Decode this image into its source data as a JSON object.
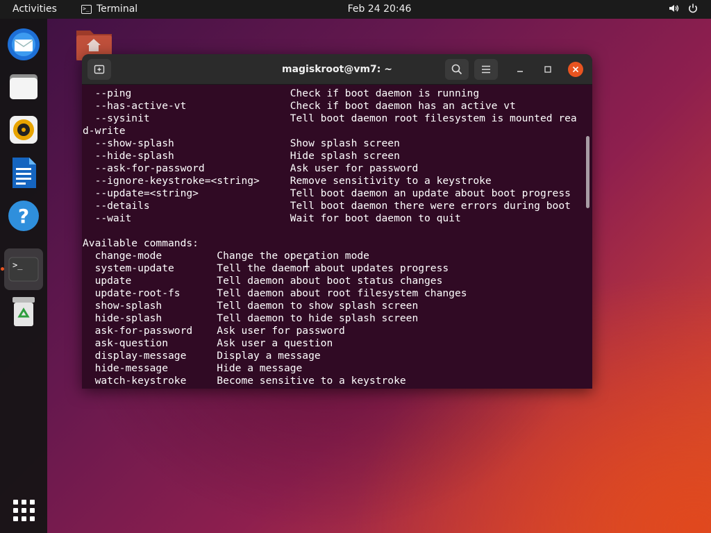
{
  "topbar": {
    "activities": "Activities",
    "app_name": "Terminal",
    "app_icon_glyph": ">_",
    "clock": "Feb 24  20:46",
    "icons": [
      "volume-icon",
      "power-icon"
    ]
  },
  "dock": {
    "items": [
      "thunderbird-icon",
      "files-icon",
      "rhythmbox-icon",
      "libreoffice-writer-icon",
      "help-icon",
      "terminal-icon",
      "trash-icon"
    ],
    "active": "terminal-icon",
    "show_apps": "show-applications-icon"
  },
  "desktop": {
    "icons": [
      "home-folder-icon"
    ]
  },
  "terminal": {
    "title": "magiskroot@vm7: ~",
    "accent": "#e95420",
    "background": "#300a24",
    "lines": [
      "  --ping                          Check if boot daemon is running",
      "  --has-active-vt                 Check if boot daemon has an active vt",
      "  --sysinit                       Tell boot daemon root filesystem is mounted rea",
      "d-write",
      "  --show-splash                   Show splash screen",
      "  --hide-splash                   Hide splash screen",
      "  --ask-for-password              Ask user for password",
      "  --ignore-keystroke=<string>     Remove sensitivity to a keystroke",
      "  --update=<string>               Tell boot daemon an update about boot progress",
      "  --details                       Tell boot daemon there were errors during boot",
      "  --wait                          Wait for boot daemon to quit",
      "",
      "Available commands:",
      "  change-mode         Change the operation mode",
      "  system-update       Tell the daemon about updates progress",
      "  update              Tell daemon about boot status changes",
      "  update-root-fs      Tell daemon about root filesystem changes",
      "  show-splash         Tell daemon to show splash screen",
      "  hide-splash         Tell daemon to hide splash screen",
      "  ask-for-password    Ask user for password",
      "  ask-question        Ask user a question",
      "  display-message     Display a message",
      "  hide-message        Hide a message",
      "  watch-keystroke     Become sensitive to a keystroke"
    ]
  }
}
